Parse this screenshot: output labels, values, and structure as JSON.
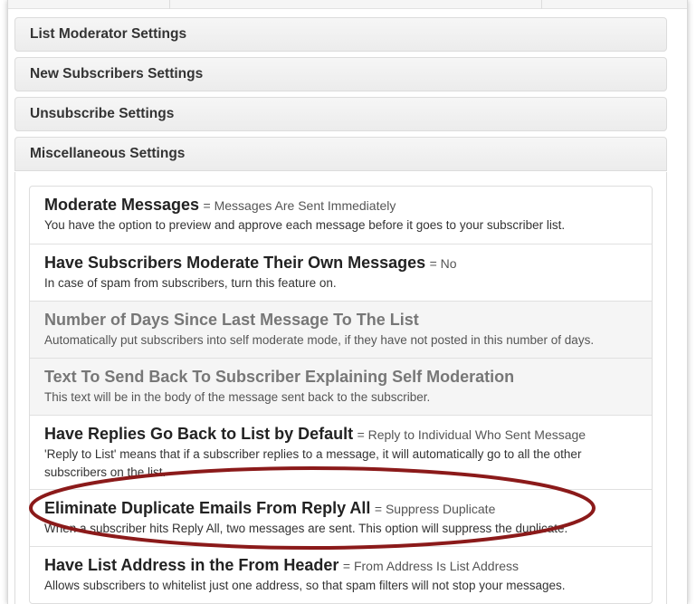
{
  "sections": [
    {
      "label": "List Moderator Settings"
    },
    {
      "label": "New Subscribers Settings"
    },
    {
      "label": "Unsubscribe Settings"
    },
    {
      "label": "Miscellaneous Settings"
    }
  ],
  "settings": [
    {
      "title": "Moderate Messages",
      "value": "= Messages Are Sent Immediately",
      "desc": "You have the option to preview and approve each message before it goes to your subscriber list."
    },
    {
      "title": "Have Subscribers Moderate Their Own Messages",
      "value": "= No",
      "desc": "In case of spam from subscribers, turn this feature on."
    },
    {
      "title": "Number of Days Since Last Message To The List",
      "value": "",
      "desc": "Automatically put subscribers into self moderate mode, if they have not posted in this number of days."
    },
    {
      "title": "Text To Send Back To Subscriber Explaining Self Moderation",
      "value": "",
      "desc": "This text will be in the body of the message sent back to the subscriber."
    },
    {
      "title": "Have Replies Go Back to List by Default",
      "value": "= Reply to Individual Who Sent Message",
      "desc": "'Reply to List' means that if a subscriber replies to a message, it will automatically go to all the other subscribers on the list."
    },
    {
      "title": "Eliminate Duplicate Emails From Reply All",
      "value": "= Suppress Duplicate",
      "desc": "When a subscriber hits Reply All, two messages are sent. This option will suppress the duplicate."
    },
    {
      "title": "Have List Address in the From Header",
      "value": "= From Address Is List Address",
      "desc": "Allows subscribers to whitelist just one address, so that spam filters will not stop your messages."
    }
  ],
  "colors": {
    "annotation_ellipse": "#8b1a1a"
  }
}
